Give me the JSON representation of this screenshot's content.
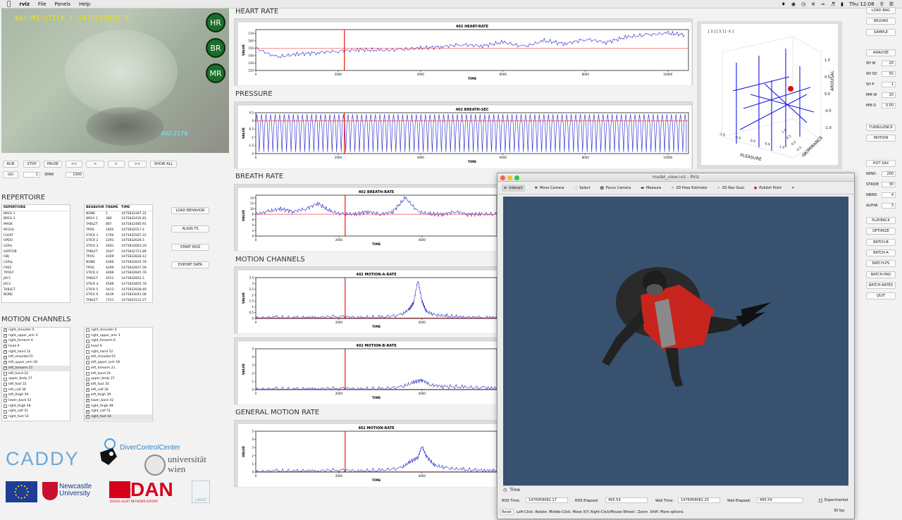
{
  "menubar": {
    "apple": "",
    "app": "rviz",
    "items": [
      "File",
      "Panels",
      "Help"
    ],
    "clock": "Thu 12:08"
  },
  "camera": {
    "overlay": "402:M3:STICK 1:1475832815.3",
    "bottom_label": "402:2178",
    "badges": [
      "HR",
      "BR",
      "MR"
    ]
  },
  "controls": {
    "row1": [
      "RUN",
      "STOP",
      "PAUSE",
      "<<",
      "<",
      ">",
      ">>",
      "SHOW ALL"
    ],
    "go_label": "GO",
    "go_value": "1",
    "span_label": "SPAN",
    "span_value": "1000"
  },
  "repertoire": {
    "title": "REPERTOIRE",
    "list_header": "REPERTOIRE",
    "items": [
      "BREA 1",
      "BREA 2",
      "MASK",
      "REGUL",
      "FLOAT",
      "UPDO",
      "LERIs",
      "SORTOB",
      "OBJ",
      "LERIq",
      "FREE",
      "TPOST",
      "JAC1",
      "JAC2",
      "TABLET",
      "NONE"
    ],
    "table_headers": [
      "BEHAVIOR",
      "FRAME",
      "TIME"
    ],
    "rows": [
      [
        "NONE",
        "1",
        "1475832397.31"
      ],
      [
        "BREA 1",
        "386",
        "1475832435.81"
      ],
      [
        "TABLET",
        "887",
        "1475832485.91"
      ],
      [
        "TPOS",
        "1602",
        "1475832557.4"
      ],
      [
        "STICK 1",
        "1700",
        "1475832567.22"
      ],
      [
        "STICK 2",
        "2293",
        "1475832626.5"
      ],
      [
        "STICK 3",
        "2681",
        "1475832665.29"
      ],
      [
        "TABLET",
        "3247",
        "1475832721.89"
      ],
      [
        "TPOS",
        "4309",
        "1475832828.12"
      ],
      [
        "NONE",
        "4386",
        "1475832835.78"
      ],
      [
        "TPOS",
        "4399",
        "1475832837.09"
      ],
      [
        "STICK 4",
        "4486",
        "1475832845.78"
      ],
      [
        "TABLET",
        "4553",
        "1475832852.5"
      ],
      [
        "STICK 4",
        "4586",
        "1475832855.78"
      ],
      [
        "STICK 5",
        "5413",
        "1475832938.49"
      ],
      [
        "STICK 6",
        "6439",
        "1475833041.08"
      ],
      [
        "TABLET",
        "7151",
        "1475833112.27"
      ]
    ],
    "buttons": [
      "LOAD BEHAVIOR",
      "ALIGN TS",
      "START RVIZ",
      "EXPORT DATA"
    ]
  },
  "motion_channels": {
    "title": "MOTION CHANNELS",
    "left": [
      [
        "right_shoulder 0",
        true
      ],
      [
        "right_upper_arm 3",
        true
      ],
      [
        "right_forearm 6",
        true
      ],
      [
        "head 9",
        true
      ],
      [
        "right_hand 12",
        true
      ],
      [
        "left_shoulder15",
        true
      ],
      [
        "left_upper_arm 18",
        true
      ],
      [
        "left_forearm 21",
        true
      ],
      [
        "left_hand 24",
        false
      ],
      [
        "upper_body 27",
        false
      ],
      [
        "left_foot 33",
        false
      ],
      [
        "left_calf 36",
        false
      ],
      [
        "left_thigh 39",
        false
      ],
      [
        "lower_back 42",
        false
      ],
      [
        "right_thigh 48",
        false
      ],
      [
        "right_calf 51",
        false
      ],
      [
        "right_foot 54",
        false
      ]
    ],
    "right": [
      [
        "right_shoulder 0",
        false
      ],
      [
        "right_upper_arm 3",
        false
      ],
      [
        "right_forearm 6",
        false
      ],
      [
        "head 9",
        false
      ],
      [
        "right_hand 12",
        false
      ],
      [
        "left_shoulder15",
        false
      ],
      [
        "left_upper_arm 18",
        false
      ],
      [
        "left_forearm 21",
        false
      ],
      [
        "left_hand 24",
        false
      ],
      [
        "upper_body 27",
        false
      ],
      [
        "left_foot 33",
        true
      ],
      [
        "left_calf 36",
        true
      ],
      [
        "left_thigh 39",
        true
      ],
      [
        "lower_back 42",
        true
      ],
      [
        "right_thigh 48",
        true
      ],
      [
        "right_calf 51",
        true
      ],
      [
        "right_foot 54",
        true
      ]
    ]
  },
  "logos": {
    "caddy": "CADDY",
    "dcc": "DiverControlCenter",
    "univ1": "universität",
    "univ2": "wien",
    "newcastle1": "Newcastle",
    "newcastle2": "University",
    "dan": "DAN",
    "dan_sub": "DIVERS ALERT NETWORK EUROPE",
    "labust": "LABUST"
  },
  "sections": {
    "heart": "HEART RATE",
    "pressure": "PRESSURE",
    "breath": "BREATH RATE",
    "motion": "MOTION CHANNELS",
    "general": "GENERAL MOTION RATE"
  },
  "charts": {
    "xlabel": "TIME",
    "ylabel": "VALUE"
  },
  "chart_data": [
    {
      "type": "line",
      "title": "402 HEART-RATE",
      "xlabel": "TIME",
      "ylabel": "VALUE",
      "xlim": [
        0,
        10500
      ],
      "ylim": [
        120,
        175
      ],
      "xticks": [
        0,
        2000,
        4000,
        6000,
        8000,
        10000
      ],
      "yticks": [
        120,
        130,
        140,
        150,
        160,
        170
      ],
      "marker_x": 2150,
      "threshold": 150,
      "x": [
        0,
        500,
        1000,
        1500,
        2000,
        2500,
        3000,
        3500,
        4000,
        4500,
        5000,
        5500,
        6000,
        6500,
        7000,
        7500,
        8000,
        8500,
        9000,
        9500,
        10000,
        10400
      ],
      "values": [
        150,
        138,
        142,
        144,
        146,
        148,
        147,
        148,
        150,
        152,
        155,
        153,
        158,
        152,
        160,
        156,
        162,
        158,
        165,
        168,
        170,
        168
      ]
    },
    {
      "type": "line",
      "title": "402 BREATH-SEC",
      "xlabel": "TIME",
      "ylabel": "VALUE",
      "xlim": [
        0,
        10500
      ],
      "ylim": [
        -2.0,
        0.5
      ],
      "xticks": [
        0,
        2000,
        4000,
        6000,
        8000,
        10000
      ],
      "yticks": [
        -2.0,
        -1.5,
        -1.0,
        -0.5,
        0.0,
        0.5
      ],
      "marker_x": 2150,
      "threshold": 0.0,
      "cycles": 95,
      "min": -1.9,
      "max": 0.4
    },
    {
      "type": "line",
      "title": "402 BREATH-RATE",
      "xlabel": "TIME",
      "ylabel": "VALUE",
      "xlim": [
        0,
        5800
      ],
      "ylim": [
        0,
        15
      ],
      "xticks": [
        0,
        2000,
        4000
      ],
      "yticks": [
        0,
        2,
        4,
        6,
        8,
        10,
        12,
        14
      ],
      "marker_x": 2150,
      "threshold": 8,
      "x": [
        0,
        300,
        600,
        900,
        1200,
        1500,
        1800,
        2100,
        2400,
        2700,
        3000,
        3300,
        3600,
        3900,
        4200,
        4500,
        4800,
        5100,
        5400,
        5800
      ],
      "values": [
        8,
        9,
        10,
        9,
        10,
        12,
        9,
        8,
        8,
        9,
        8,
        9,
        14,
        9,
        8,
        8,
        9,
        8,
        8,
        8
      ]
    },
    {
      "type": "line",
      "title": "402 MOTION-A-RATE",
      "xlabel": "TIME",
      "ylabel": "VALUE",
      "xlim": [
        0,
        5800
      ],
      "ylim": [
        0,
        3.5
      ],
      "xticks": [
        0,
        2000,
        4000
      ],
      "yticks": [
        0.0,
        0.5,
        1.0,
        1.5,
        2.0,
        2.5,
        3.0,
        3.5
      ],
      "marker_x": 2150,
      "threshold": 0.05,
      "x": [
        0,
        500,
        1000,
        1500,
        2000,
        2500,
        3000,
        3500,
        3700,
        3800,
        3900,
        4000,
        4100,
        4300,
        4600,
        5000,
        5500,
        5800
      ],
      "values": [
        0.05,
        0.1,
        0.05,
        0.1,
        0.2,
        0.05,
        0.1,
        0.3,
        0.8,
        1.4,
        3.3,
        1.5,
        0.6,
        0.3,
        0.2,
        0.1,
        0.1,
        0.1
      ]
    },
    {
      "type": "line",
      "title": "402 MOTION-B-RATE",
      "xlabel": "TIME",
      "ylabel": "VALUE",
      "xlim": [
        0,
        5800
      ],
      "ylim": [
        0,
        5
      ],
      "xticks": [
        0,
        2000,
        4000
      ],
      "yticks": [
        0,
        1,
        2,
        3,
        4,
        5
      ],
      "marker_x": 2150,
      "threshold": 0.05,
      "x": [
        0,
        500,
        1000,
        1500,
        2000,
        2500,
        3000,
        3500,
        3800,
        4000,
        4200,
        4500,
        5000,
        5500,
        5800
      ],
      "values": [
        0.05,
        0.1,
        0.05,
        0.1,
        0.2,
        0.05,
        0.1,
        0.3,
        0.9,
        1.2,
        0.6,
        0.4,
        0.3,
        0.2,
        0.2
      ]
    },
    {
      "type": "line",
      "title": "402 MOTION-RATE",
      "xlabel": "TIME",
      "ylabel": "VALUE",
      "xlim": [
        0,
        5800
      ],
      "ylim": [
        0,
        5
      ],
      "xticks": [
        0,
        2000,
        4000
      ],
      "yticks": [
        0,
        1,
        2,
        3,
        4,
        5
      ],
      "marker_x": 2150,
      "threshold": 0.05,
      "x": [
        0,
        500,
        1000,
        1500,
        2000,
        2500,
        3000,
        3500,
        3700,
        3900,
        4000,
        4100,
        4300,
        4600,
        5000,
        5500,
        5800
      ],
      "values": [
        0.05,
        0.15,
        0.1,
        0.15,
        0.3,
        0.1,
        0.2,
        0.5,
        1.2,
        1.8,
        3.2,
        2.0,
        0.8,
        0.5,
        0.3,
        0.2,
        0.2
      ]
    }
  ],
  "plot3d": {
    "title": "[ 1 ] [ 1 ] [ -1 ]",
    "xlabel": "PLEASURE",
    "ylabel": "DOMINANCE",
    "zlabel": "AROUSAL",
    "zticks": [
      "1.0",
      "0.5",
      "0.0",
      "-0.5",
      "-1.0"
    ],
    "xticks": [
      "-1.0",
      "-0.5",
      "0.0",
      "0.5",
      "1.0"
    ],
    "yticks": [
      "1.0",
      "0.5",
      "0.0",
      "-0.5",
      "-1.0"
    ]
  },
  "right_panel": {
    "top_buttons": [
      "LOAD BAG",
      "RELOAD",
      "SAMPLE"
    ],
    "analyze": "ANALYZE",
    "params": [
      [
        "SH W",
        "20"
      ],
      [
        "SH SD",
        "50"
      ],
      [
        "SH P",
        "1"
      ],
      [
        "MM W",
        "10"
      ],
      [
        "MM D",
        "0.00"
      ]
    ],
    "mid_buttons": [
      "TURBULENCE",
      "MOTION"
    ],
    "hot_sax": "HOT SAX",
    "params2": [
      [
        "WIND",
        "200"
      ],
      [
        "STRIDE",
        "30"
      ],
      [
        "NBINS",
        "4"
      ],
      [
        "ALPHA",
        "3"
      ]
    ],
    "bottom_buttons": [
      "PLAYBACK",
      "OPTIMIZE",
      "BATCH-B",
      "BATCH-A",
      "BATCH-PS",
      "BATCH-PAD",
      "BATCH-RATES",
      "QUIT"
    ]
  },
  "rviz": {
    "title": "model_view.rviz - RViz",
    "tools": [
      "Interact",
      "Move Camera",
      "Select",
      "Focus Camera",
      "Measure",
      "2D Pose Estimate",
      "2D Nav Goal",
      "Publish Point"
    ],
    "time_panel": "Time",
    "ros_time_label": "ROS Time:",
    "ros_time": "1476958082.17",
    "ros_elapsed_label": "ROS Elapsed:",
    "ros_elapsed": "495.54",
    "wall_time_label": "Wall Time:",
    "wall_time": "1476958082.20",
    "wall_elapsed_label": "Wall Elapsed:",
    "wall_elapsed": "495.54",
    "experimental": "Experimental",
    "reset": "Reset",
    "hint": "Left-Click: Rotate. Middle-Click: Move X/Y. Right-Click/Mouse Wheel:: Zoom. Shift: More options.",
    "fps": "30 fps"
  }
}
